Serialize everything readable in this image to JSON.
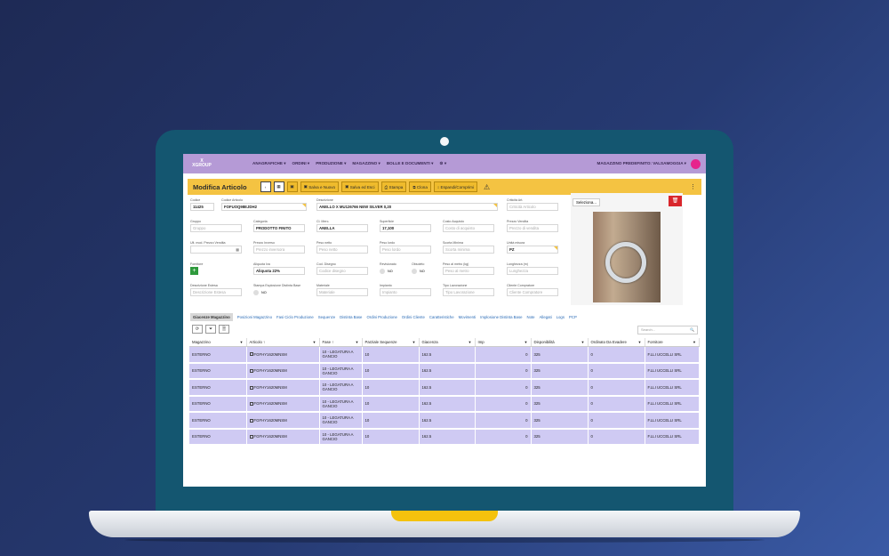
{
  "nav": {
    "logo_line1": "X",
    "logo_line2": "XGROUP",
    "menu": [
      "ANAGRAFICHE ▾",
      "ORDINI ▾",
      "PRODUZIONE ▾",
      "MAGAZZINO ▾",
      "BOLLE E DOCUMENTI ▾",
      "⚙ ▾"
    ],
    "warehouse": "MAGAZZINO PREDEFINITO: VALSAMOGGIA ▾"
  },
  "toolbar": {
    "title": "Modifica Articolo",
    "back": "‹",
    "save_new": "Salva e Nuovo",
    "save_exit": "Salva ed Esci",
    "print": "Stampa",
    "clone": "Clona",
    "expand": "Espandi/Comprimi",
    "warning": "⚠",
    "more": "⋮"
  },
  "form": {
    "codice": {
      "label": "Codice",
      "value": "11425"
    },
    "codice_articolo": {
      "label": "Codice Articolo",
      "value": "FOFUOQ98EJDH2"
    },
    "descrizione": {
      "label": "Descrizione",
      "value": "ANELLO X MU126766 NEW SILVER 0,20"
    },
    "criticita": {
      "label": "Criticità Art.",
      "placeholder": "Criticità Articolo"
    },
    "gruppo": {
      "label": "Gruppo",
      "placeholder": "Gruppo"
    },
    "categoria": {
      "label": "Categoria",
      "value": "PRODOTTO FINITO"
    },
    "cl_merc": {
      "label": "Cl. Merc.",
      "value": "ANELLA"
    },
    "superficie": {
      "label": "Superficie",
      "value": "17,100"
    },
    "costo_acquisto": {
      "label": "Costo Acquisto",
      "placeholder": "Costo di acquisto"
    },
    "prezzo_vendita": {
      "label": "Prezzo Vendita",
      "placeholder": "Prezzo di vendita"
    },
    "ult_mod": {
      "label": "Ult. mod. Prezzo Vendita",
      "value": ""
    },
    "prezzo_inverso": {
      "label": "Prezzo Inverso",
      "placeholder": "Prezzo inversora"
    },
    "peso_netto": {
      "label": "Peso netto",
      "placeholder": "Peso netto"
    },
    "peso_lordo": {
      "label": "Peso lordo",
      "placeholder": "Peso lordo"
    },
    "scorta_minima": {
      "label": "Scorta Minima",
      "placeholder": "Scorta minima"
    },
    "unita_misura": {
      "label": "Unità misura",
      "value": "PZ"
    },
    "fornitore": {
      "label": "Fornitore"
    },
    "aliquota": {
      "label": "Aliquota Iva",
      "value": "Aliquota 22%"
    },
    "cod_disegno": {
      "label": "Cod. Disegno",
      "placeholder": "Codice disegno"
    },
    "revisionato": {
      "label": "Revisionato",
      "value": "NO"
    },
    "obsoleto": {
      "label": "Obsoleto",
      "value": "NO"
    },
    "peso_metro": {
      "label": "Peso al metro (kg)",
      "placeholder": "Peso al metro"
    },
    "lunghezza": {
      "label": "Lunghezza (m)",
      "placeholder": "Lunghezza"
    },
    "desc_estesa": {
      "label": "Descrizione Estesa",
      "placeholder": "Descrizione Estesa"
    },
    "stampa_esplosione": {
      "label": "Stampa Esplosione Distinta Base",
      "value": "NO"
    },
    "materiale": {
      "label": "Materiale",
      "placeholder": "Materiale"
    },
    "impianto": {
      "label": "Impianto",
      "placeholder": "Impianto"
    },
    "tipo_lavorazione": {
      "label": "Tipo Lavorazione",
      "placeholder": "Tipo Lavorazione"
    },
    "cliente_compratore": {
      "label": "Cliente Compratore",
      "placeholder": "Cliente Compratore"
    },
    "image_select": "Seleziona...",
    "delete_icon": "🗑"
  },
  "tabs": [
    "Giacenze Magazzino",
    "Posizioni Magazzino",
    "Fasi Ciclo Produzione",
    "Sequenze",
    "Distinta Base",
    "Ordini Produzione",
    "Ordini Cliente",
    "Caratteristiche",
    "Movimenti",
    "Implosione Distinta Base",
    "Note",
    "Allegati",
    "Logs",
    "PCP"
  ],
  "grid": {
    "search_placeholder": "Search...",
    "search_icon": "🔍",
    "refresh_icon": "⟳",
    "filter_icon": "⏷",
    "export_icon": "🗎",
    "columns": [
      "Magazzino",
      "Articolo",
      "Fase",
      "Parziale Sequenze",
      "Giacenza",
      "Imp",
      "Disponibilità",
      "Ordinato Da Evadere",
      "Fornitore"
    ],
    "rows": [
      {
        "magazzino": "ESTERNO",
        "articolo": "FGFHY1620MNSM",
        "fase": "10 - LEGATURA A GANCIO",
        "parziale": "10",
        "giacenza": "162.5",
        "imp": "0",
        "disp": "325",
        "ordinato": "0",
        "fornitore": "F.LLI UCCELLI SRL"
      },
      {
        "magazzino": "ESTERNO",
        "articolo": "FGFHY1620MNSM",
        "fase": "10 - LEGATURA A GANCIO",
        "parziale": "10",
        "giacenza": "162.5",
        "imp": "0",
        "disp": "325",
        "ordinato": "0",
        "fornitore": "F.LLI UCCELLI SRL"
      },
      {
        "magazzino": "ESTERNO",
        "articolo": "FGFHY1620MNSM",
        "fase": "10 - LEGATURA A GANCIO",
        "parziale": "10",
        "giacenza": "162.5",
        "imp": "0",
        "disp": "325",
        "ordinato": "0",
        "fornitore": "F.LLI UCCELLI SRL"
      },
      {
        "magazzino": "ESTERNO",
        "articolo": "FGFHY1620MNSM",
        "fase": "10 - LEGATURA A GANCIO",
        "parziale": "10",
        "giacenza": "162.5",
        "imp": "0",
        "disp": "325",
        "ordinato": "0",
        "fornitore": "F.LLI UCCELLI SRL"
      },
      {
        "magazzino": "ESTERNO",
        "articolo": "FGFHY1620MNSM",
        "fase": "10 - LEGATURA A GANCIO",
        "parziale": "10",
        "giacenza": "162.5",
        "imp": "0",
        "disp": "325",
        "ordinato": "0",
        "fornitore": "F.LLI UCCELLI SRL"
      },
      {
        "magazzino": "ESTERNO",
        "articolo": "FGFHY1620MNSM",
        "fase": "10 - LEGATURA A GANCIO",
        "parziale": "10",
        "giacenza": "162.5",
        "imp": "0",
        "disp": "325",
        "ordinato": "0",
        "fornitore": "F.LLI UCCELLI SRL"
      }
    ]
  }
}
